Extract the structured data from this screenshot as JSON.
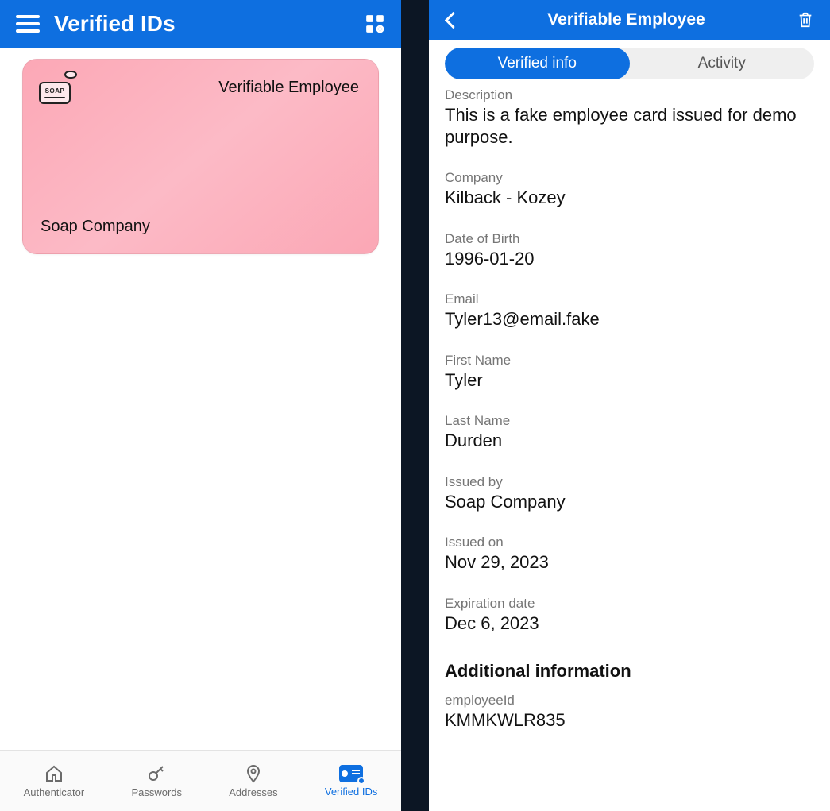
{
  "left": {
    "title": "Verified IDs",
    "card": {
      "iconText": "SOAP",
      "type": "Verifiable Employee",
      "issuer": "Soap Company"
    },
    "nav": {
      "authenticator": "Authenticator",
      "passwords": "Passwords",
      "addresses": "Addresses",
      "verifiedIds": "Verified IDs"
    }
  },
  "right": {
    "title": "Verifiable Employee",
    "tabs": {
      "verifiedInfo": "Verified info",
      "activity": "Activity"
    },
    "fields": {
      "descriptionLabel": "Description",
      "descriptionValue": "This is a fake employee card issued for demo purpose.",
      "companyLabel": "Company",
      "companyValue": "Kilback - Kozey",
      "dobLabel": "Date of Birth",
      "dobValue": "1996-01-20",
      "emailLabel": "Email",
      "emailValue": "Tyler13@email.fake",
      "firstNameLabel": "First Name",
      "firstNameValue": "Tyler",
      "lastNameLabel": "Last Name",
      "lastNameValue": "Durden",
      "issuedByLabel": "Issued by",
      "issuedByValue": "Soap Company",
      "issuedOnLabel": "Issued on",
      "issuedOnValue": "Nov 29, 2023",
      "expirationLabel": "Expiration date",
      "expirationValue": "Dec 6, 2023",
      "additionalHeading": "Additional information",
      "employeeIdLabel": "employeeId",
      "employeeIdValue": "KMMKWLR835"
    }
  }
}
